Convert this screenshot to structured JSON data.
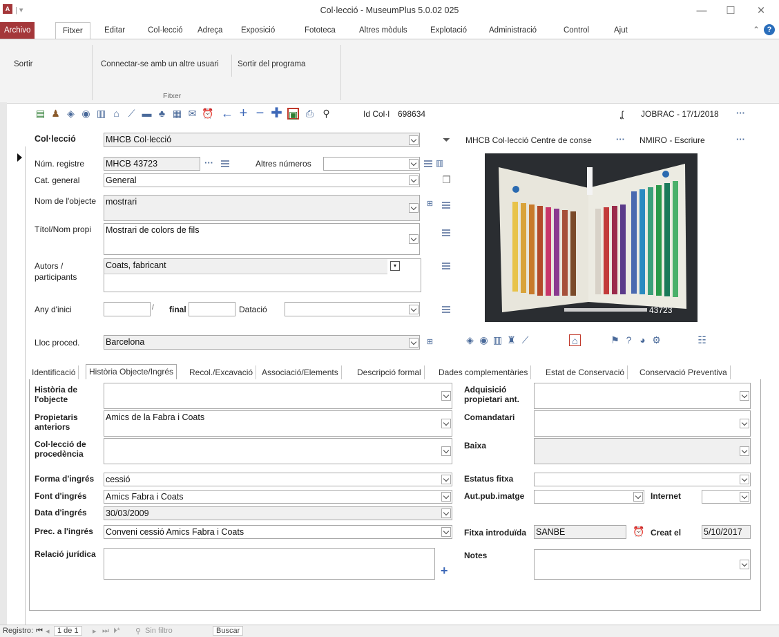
{
  "window": {
    "title": "Col·lecció - MuseumPlus 5.0.02 025",
    "minimize": "—",
    "maximize": "☐",
    "close": "✕"
  },
  "menu": {
    "tabs": [
      "Archivo",
      "Fitxer",
      "Editar",
      "Col·lecció",
      "Adreça",
      "Exposició",
      "Fototeca",
      "Altres mòduls",
      "Explotació",
      "Administració",
      "Control",
      "Ajut"
    ]
  },
  "ribbon": {
    "sortir": "Sortir",
    "connect": "Connectar-se amb un altre usuari",
    "exit_program": "Sortir del programa",
    "group_label": "Fitxer"
  },
  "header": {
    "id_label": "Id Col·l",
    "id_value": "698634",
    "user_date": "JOBRAC - 17/1/2018",
    "location": "MHCB Col·lecció Centre de conse",
    "permission": "NMIRO - Escriure"
  },
  "form": {
    "collection_label": "Col·lecció",
    "collection_value": "MHCB Col·lecció",
    "num_registre_label": "Núm. registre",
    "num_registre_value": "MHCB 43723",
    "altres_numeros_label": "Altres números",
    "cat_general_label": "Cat. general",
    "cat_general_value": "General",
    "nom_objecte_label": "Nom de l'objecte",
    "nom_objecte_value": "mostrari",
    "titol_label": "Títol/Nom propi",
    "titol_value": "Mostrari de colors de fils",
    "autors_label": "Autors / participants",
    "autors_value": "Coats, fabricant",
    "any_inici_label": "Any d'inici",
    "final_label": "final",
    "datacio_label": "Datació",
    "lloc_label": "Lloc proced.",
    "lloc_value": "Barcelona"
  },
  "photo": {
    "caption": "43723"
  },
  "subtabs": [
    "Identificació",
    "Història Objecte/Ingrés",
    "Recol./Excavació",
    "Associació/Elements",
    "Descripció formal",
    "Dades complementàries",
    "Estat de Conservació",
    "Conservació Preventiva"
  ],
  "history": {
    "historia_label": "Història de l'objecte",
    "propietaris_label": "Propietaris anteriors",
    "propietaris_value": "Amics de la Fabra i Coats",
    "colleccio_proc_label": "Col·lecció de procedència",
    "forma_label": "Forma d'ingrés",
    "forma_value": "cessió",
    "font_label": "Font d'ingrés",
    "font_value": "Amics Fabra i Coats",
    "data_label": "Data d'ingrés",
    "data_value": "30/03/2009",
    "prec_label": "Prec. a l'ingrés",
    "prec_value": "Conveni cessió Amics Fabra i Coats",
    "relacio_label": "Relació jurídica",
    "adquisicio_label": "Adquisició propietari ant.",
    "comandatari_label": "Comandatari",
    "baixa_label": "Baixa",
    "estatus_label": "Estatus fitxa",
    "autpub_label": "Aut.pub.imatge",
    "internet_label": "Internet",
    "fitxa_intro_label": "Fitxa introduïda",
    "fitxa_intro_value": "SANBE",
    "creat_label": "Creat el",
    "creat_value": "5/10/2017",
    "notes_label": "Notes"
  },
  "status": {
    "registro": "Registro:",
    "position": "1 de 1",
    "filter": "Sin filtro",
    "search": "Buscar"
  }
}
